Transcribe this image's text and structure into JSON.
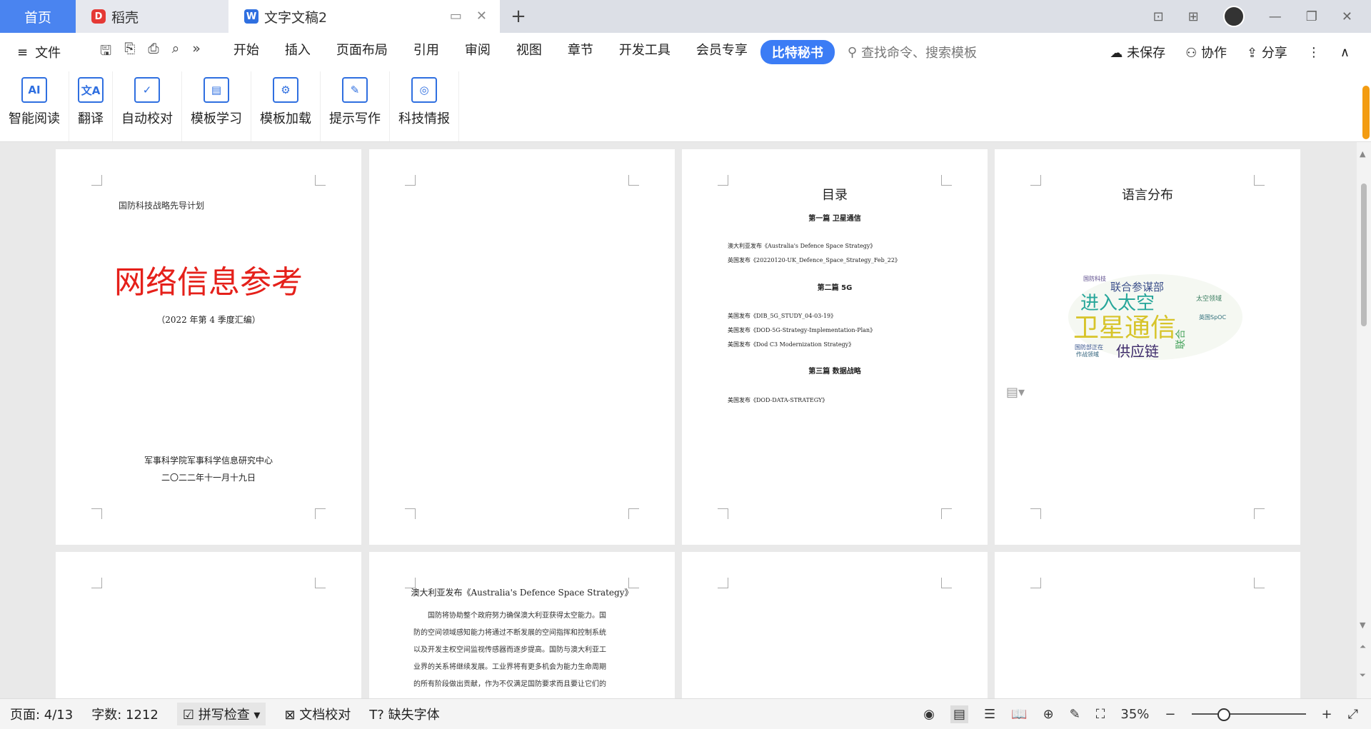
{
  "titlebar": {
    "home_tab": "首页",
    "tab_daoke": "稻壳",
    "tab_doc": "文字文稿2"
  },
  "menubar": {
    "file": "文件",
    "menus": [
      "开始",
      "插入",
      "页面布局",
      "引用",
      "审阅",
      "视图",
      "章节",
      "开发工具",
      "会员专享"
    ],
    "active_menu": "比特秘书",
    "search_placeholder": "查找命令、搜索模板",
    "unsaved": "未保存",
    "collaborate": "协作",
    "share": "分享"
  },
  "ribbon": [
    {
      "label": "智能阅读",
      "icon": "ai-read-icon"
    },
    {
      "label": "翻译",
      "icon": "translate-icon"
    },
    {
      "label": "自动校对",
      "icon": "proofread-icon"
    },
    {
      "label": "模板学习",
      "icon": "template-learn-icon"
    },
    {
      "label": "模板加载",
      "icon": "template-load-icon"
    },
    {
      "label": "提示写作",
      "icon": "prompt-write-icon"
    },
    {
      "label": "科技情报",
      "icon": "tech-intel-icon"
    }
  ],
  "page1": {
    "header": "国防科技战略先导计划",
    "title": "网络信息参考",
    "subtitle": "（2022 年第 4 季度汇编）",
    "org": "军事科学院军事科学信息研究中心",
    "date": "二〇二二年十一月十九日"
  },
  "toc": {
    "title": "目录",
    "sections": [
      {
        "heading": "第一篇  卫星通信",
        "items": [
          "澳大利亚发布《Australia's Defence Space Strategy》",
          "英国发布《20220120-UK_Defence_Space_Strategy_Feb_22》"
        ]
      },
      {
        "heading": "第二篇  5G",
        "items": [
          "美国发布《DIB_5G_STUDY_04-03-19》",
          "美国发布《DOD-5G-Strategy-Implementation-Plan》",
          "美国发布《Dod C3 Modernization Strategy》"
        ]
      },
      {
        "heading": "第三篇  数据战略",
        "items": [
          "美国发布《DOD-DATA-STRATEGY》"
        ]
      }
    ]
  },
  "lang_page": {
    "title": "语言分布",
    "cloud_words": [
      "联合参谋部",
      "进入太空",
      "卫星通信",
      "供应链",
      "国防部正在",
      "作战领域",
      "英国SpOC",
      "太空领域",
      "国防科技"
    ]
  },
  "article": {
    "title": "澳大利亚发布《Australia's Defence Space Strategy》",
    "lines": [
      "国防将协助整个政府努力确保澳大利亚获得太空能力。国",
      "防的空间领域感知能力将通过不断发展的空间指挥和控制系统",
      "以及开发主权空间监视传感器而逐步提高。国防与澳大利亚工",
      "业界的关系将继续发展。工业界将有更多机会为能力生命周期",
      "的所有阶段做出贡献，作为不仅满足国防要求而且要让它们的"
    ]
  },
  "status": {
    "page": "页面: 4/13",
    "words": "字数: 1212",
    "spell": "拼写检查",
    "doc_check": "文档校对",
    "missing_font": "缺失字体",
    "zoom": "35%"
  },
  "colors": {
    "accent": "#3b7cf5",
    "title_red": "#e5201a"
  }
}
